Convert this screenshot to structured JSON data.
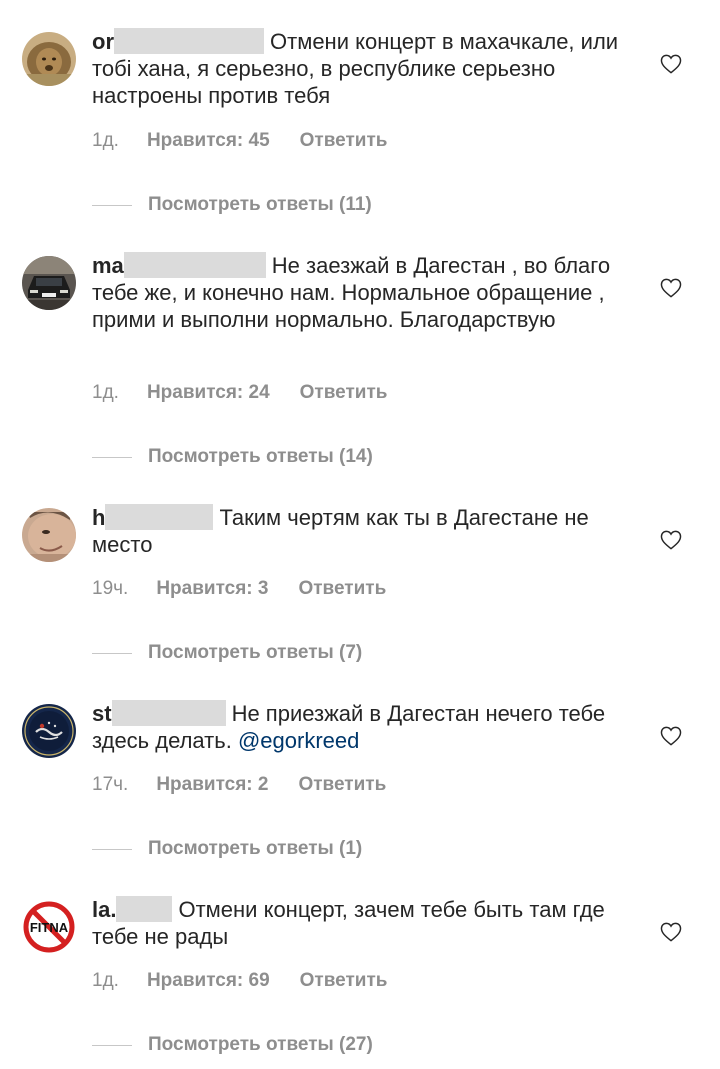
{
  "like_icon": "heart-outline-icon",
  "comments": [
    {
      "username": "or",
      "text": "Отмени концерт в махачкале, или тобі хана, я серьезно, в республике серьезно настроены против тебя",
      "mention": "",
      "time": "1д.",
      "likes": "Нравится: 45",
      "reply": "Ответить",
      "view_replies": "Посмотреть ответы (11)",
      "avatar": "lion-photo"
    },
    {
      "username": "ma",
      "text": "Не заезжай в Дагестан , во благо тебе же, и конечно нам. Нормальное обращение , прими и выполни нормально. Благодарствую",
      "mention": "",
      "time": "1д.",
      "likes": "Нравится: 24",
      "reply": "Ответить",
      "view_replies": "Посмотреть ответы (14)",
      "avatar": "car-photo"
    },
    {
      "username": "h",
      "text": "Таким чертям как ты в Дагестане не место",
      "mention": "",
      "time": "19ч.",
      "likes": "Нравится: 3",
      "reply": "Ответить",
      "view_replies": "Посмотреть ответы (7)",
      "avatar": "face-photo"
    },
    {
      "username": "st",
      "text": "Не приезжай в Дагестан нечего тебе здесь делать.",
      "mention": "@egorkreed",
      "time": "17ч.",
      "likes": "Нравится: 2",
      "reply": "Ответить",
      "view_replies": "Посмотреть ответы (1)",
      "avatar": "arabic-emblem"
    },
    {
      "username": "la.",
      "text": "Отмени концерт, зачем тебе быть там где тебе не рады",
      "mention": "",
      "time": "1д.",
      "likes": "Нравится: 69",
      "reply": "Ответить",
      "view_replies": "Посмотреть ответы (27)",
      "avatar": "no-fitna-sign",
      "avatar_text": "FITNA"
    }
  ]
}
